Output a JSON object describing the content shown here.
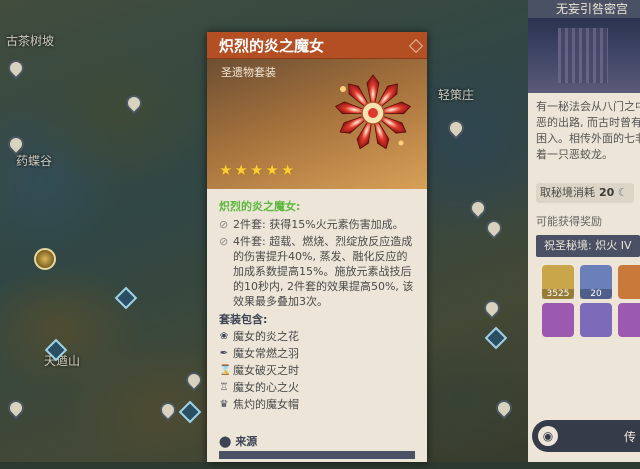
{
  "map": {
    "labels": [
      "古茶树坡",
      "药蝶谷",
      "轻策庄",
      "天遒山"
    ]
  },
  "card": {
    "title": "炽烈的炎之魔女",
    "type_label": "圣遗物套装",
    "stars": 5,
    "set_name": "炽烈的炎之魔女:",
    "bonus_glyph": "⊘",
    "bonuses": [
      "2件套: 获得15%火元素伤害加成。",
      "4件套: 超载、燃烧、烈绽放反应造成的伤害提升40%, 蒸发、融化反应的加成系数提高15%。施放元素战技后的10秒内, 2件套的效果提高50%, 该效果最多叠加3次。"
    ],
    "pieces_title": "套装包含:",
    "pieces": [
      {
        "icon": "flower-icon",
        "glyph": "❀",
        "name": "魔女的炎之花"
      },
      {
        "icon": "plume-icon",
        "glyph": "✒",
        "name": "魔女常燃之羽"
      },
      {
        "icon": "hourglass-icon",
        "glyph": "⌛",
        "name": "魔女破灭之时"
      },
      {
        "icon": "goblet-icon",
        "glyph": "♖",
        "name": "魔女的心之火"
      },
      {
        "icon": "circlet-icon",
        "glyph": "♛",
        "name": "焦灼的魔女帽"
      }
    ],
    "source_label": "来源",
    "colors": {
      "title_bar": "#b44f24",
      "set_name": "#5cb83c",
      "star": "#ffcc33"
    }
  },
  "domain_panel": {
    "header": "无妄引咎密宫",
    "desc_lines": [
      "有一秘法会从八门之中",
      "恶的出路, 而古时曾有",
      "困入。相传外面的七非",
      "着一只恶蛟龙。"
    ],
    "cost_label": "取秘境消耗",
    "cost_value": "20",
    "rewards_title": "可能获得奖励",
    "select_label": "祝圣秘境: 炽火 IV",
    "rewards": [
      {
        "icon": "mora-icon",
        "qty": "3525",
        "color": "#c9a64a"
      },
      {
        "icon": "exp-icon",
        "qty": "20",
        "color": "#6b7fb8"
      },
      {
        "icon": "artifact-icon",
        "qty": "",
        "color": "#c97a3b"
      },
      {
        "icon": "artifact-flower-icon",
        "qty": "",
        "color": "#9b5ab0"
      },
      {
        "icon": "artifact-plume-icon",
        "qty": "",
        "color": "#7b6bb8"
      },
      {
        "icon": "artifact-goblet-icon",
        "qty": "",
        "color": "#9b5ab0"
      }
    ],
    "bottom_text": "传"
  }
}
